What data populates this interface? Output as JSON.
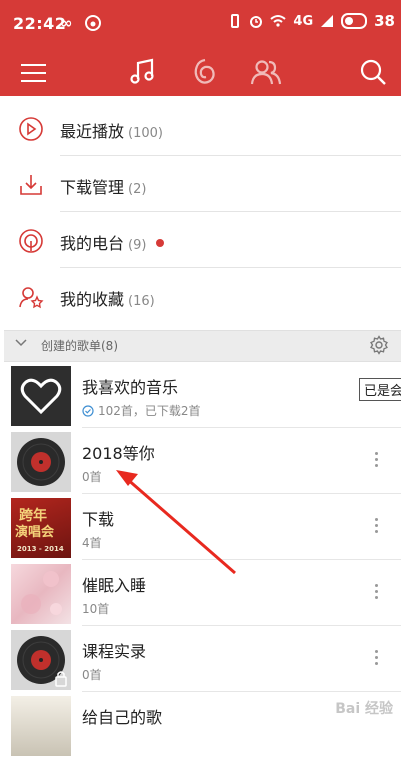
{
  "statusbar": {
    "time": "22:42",
    "icons_left": "∞",
    "battery": "38",
    "net": "4G"
  },
  "toolbar": {
    "tabs": [
      {
        "icon": "music-note-icon"
      },
      {
        "icon": "netease-disc-icon"
      },
      {
        "icon": "friends-icon"
      }
    ],
    "search_icon": "search-icon",
    "menu_icon": "hamburger-menu-icon"
  },
  "menu": [
    {
      "label": "最近播放",
      "count": "(100)",
      "icon": "recent-play-icon"
    },
    {
      "label": "下载管理",
      "count": "(2)",
      "icon": "download-icon"
    },
    {
      "label": "我的电台",
      "count": "(9)",
      "icon": "radio-icon",
      "badge": true
    },
    {
      "label": "我的收藏",
      "count": "(16)",
      "icon": "favorite-collection-icon"
    }
  ],
  "section": {
    "title": "创建的歌单(8)"
  },
  "playlists": [
    {
      "name": "我喜欢的音乐",
      "sub": "102首，已下载2首",
      "cover": "heart"
    },
    {
      "name": "2018等你",
      "sub": "0首",
      "cover": "vinyl"
    },
    {
      "name": "下载",
      "sub": "4首",
      "cover": "nianyu",
      "cover_text": "跨年\n演唱会",
      "cover_sub": "2013 - 2014"
    },
    {
      "name": "催眠入睡",
      "sub": "10首",
      "cover": "sleep"
    },
    {
      "name": "课程实录",
      "sub": "0首",
      "cover": "vinyl-lock"
    },
    {
      "name": "给自己的歌",
      "sub": "",
      "cover": "song"
    }
  ],
  "tooltip": "已是会员",
  "watermark": "Bai 经验",
  "colors": {
    "brand": "#d63a37"
  }
}
